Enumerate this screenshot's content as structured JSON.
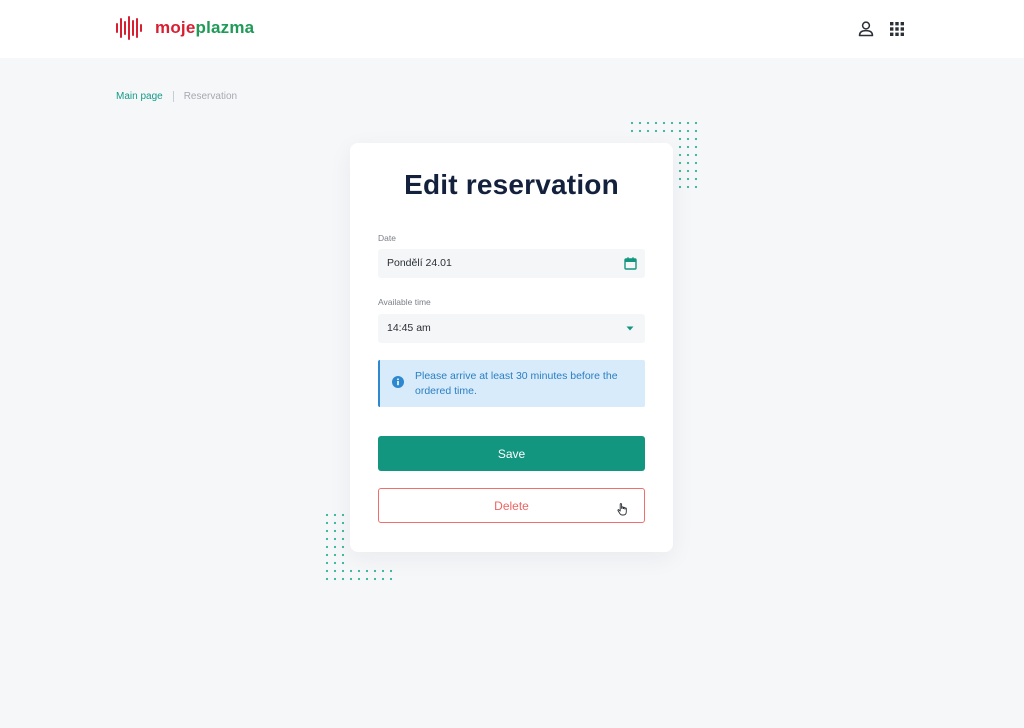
{
  "brand": {
    "name_part1": "moje",
    "name_part2": "plazma",
    "red": "#d81f32",
    "green": "#1f9a57"
  },
  "header": {
    "icons": [
      "user-icon",
      "apps-grid-icon"
    ]
  },
  "breadcrumb": {
    "main": "Main page",
    "current": "Reservation"
  },
  "card": {
    "title": "Edit reservation",
    "date": {
      "label": "Date",
      "value": "Pondělí 24.01",
      "icon": "calendar-icon"
    },
    "time": {
      "label": "Available time",
      "value": "14:45 am",
      "icon": "caret-down-icon"
    },
    "info": {
      "icon": "info-icon",
      "text": "Please arrive at least 30 minutes before the ordered time."
    },
    "save_label": "Save",
    "delete_label": "Delete"
  },
  "colors": {
    "accent": "#13967f",
    "danger": "#ef6464",
    "info_bg": "#d7ebfb",
    "info_text": "#2a7fc2",
    "title": "#14213d"
  }
}
